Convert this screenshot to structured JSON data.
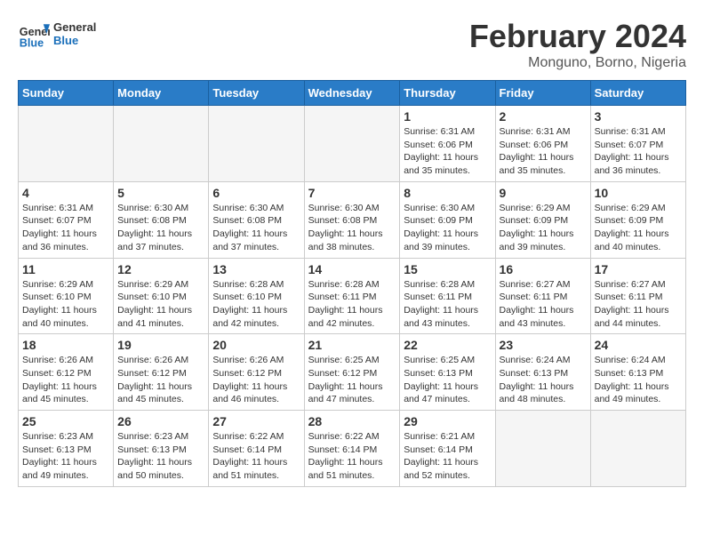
{
  "logo": {
    "text_general": "General",
    "text_blue": "Blue"
  },
  "title": "February 2024",
  "subtitle": "Monguno, Borno, Nigeria",
  "weekdays": [
    "Sunday",
    "Monday",
    "Tuesday",
    "Wednesday",
    "Thursday",
    "Friday",
    "Saturday"
  ],
  "weeks": [
    [
      {
        "day": "",
        "info": ""
      },
      {
        "day": "",
        "info": ""
      },
      {
        "day": "",
        "info": ""
      },
      {
        "day": "",
        "info": ""
      },
      {
        "day": "1",
        "info": "Sunrise: 6:31 AM\nSunset: 6:06 PM\nDaylight: 11 hours and 35 minutes."
      },
      {
        "day": "2",
        "info": "Sunrise: 6:31 AM\nSunset: 6:06 PM\nDaylight: 11 hours and 35 minutes."
      },
      {
        "day": "3",
        "info": "Sunrise: 6:31 AM\nSunset: 6:07 PM\nDaylight: 11 hours and 36 minutes."
      }
    ],
    [
      {
        "day": "4",
        "info": "Sunrise: 6:31 AM\nSunset: 6:07 PM\nDaylight: 11 hours and 36 minutes."
      },
      {
        "day": "5",
        "info": "Sunrise: 6:30 AM\nSunset: 6:08 PM\nDaylight: 11 hours and 37 minutes."
      },
      {
        "day": "6",
        "info": "Sunrise: 6:30 AM\nSunset: 6:08 PM\nDaylight: 11 hours and 37 minutes."
      },
      {
        "day": "7",
        "info": "Sunrise: 6:30 AM\nSunset: 6:08 PM\nDaylight: 11 hours and 38 minutes."
      },
      {
        "day": "8",
        "info": "Sunrise: 6:30 AM\nSunset: 6:09 PM\nDaylight: 11 hours and 39 minutes."
      },
      {
        "day": "9",
        "info": "Sunrise: 6:29 AM\nSunset: 6:09 PM\nDaylight: 11 hours and 39 minutes."
      },
      {
        "day": "10",
        "info": "Sunrise: 6:29 AM\nSunset: 6:09 PM\nDaylight: 11 hours and 40 minutes."
      }
    ],
    [
      {
        "day": "11",
        "info": "Sunrise: 6:29 AM\nSunset: 6:10 PM\nDaylight: 11 hours and 40 minutes."
      },
      {
        "day": "12",
        "info": "Sunrise: 6:29 AM\nSunset: 6:10 PM\nDaylight: 11 hours and 41 minutes."
      },
      {
        "day": "13",
        "info": "Sunrise: 6:28 AM\nSunset: 6:10 PM\nDaylight: 11 hours and 42 minutes."
      },
      {
        "day": "14",
        "info": "Sunrise: 6:28 AM\nSunset: 6:11 PM\nDaylight: 11 hours and 42 minutes."
      },
      {
        "day": "15",
        "info": "Sunrise: 6:28 AM\nSunset: 6:11 PM\nDaylight: 11 hours and 43 minutes."
      },
      {
        "day": "16",
        "info": "Sunrise: 6:27 AM\nSunset: 6:11 PM\nDaylight: 11 hours and 43 minutes."
      },
      {
        "day": "17",
        "info": "Sunrise: 6:27 AM\nSunset: 6:11 PM\nDaylight: 11 hours and 44 minutes."
      }
    ],
    [
      {
        "day": "18",
        "info": "Sunrise: 6:26 AM\nSunset: 6:12 PM\nDaylight: 11 hours and 45 minutes."
      },
      {
        "day": "19",
        "info": "Sunrise: 6:26 AM\nSunset: 6:12 PM\nDaylight: 11 hours and 45 minutes."
      },
      {
        "day": "20",
        "info": "Sunrise: 6:26 AM\nSunset: 6:12 PM\nDaylight: 11 hours and 46 minutes."
      },
      {
        "day": "21",
        "info": "Sunrise: 6:25 AM\nSunset: 6:12 PM\nDaylight: 11 hours and 47 minutes."
      },
      {
        "day": "22",
        "info": "Sunrise: 6:25 AM\nSunset: 6:13 PM\nDaylight: 11 hours and 47 minutes."
      },
      {
        "day": "23",
        "info": "Sunrise: 6:24 AM\nSunset: 6:13 PM\nDaylight: 11 hours and 48 minutes."
      },
      {
        "day": "24",
        "info": "Sunrise: 6:24 AM\nSunset: 6:13 PM\nDaylight: 11 hours and 49 minutes."
      }
    ],
    [
      {
        "day": "25",
        "info": "Sunrise: 6:23 AM\nSunset: 6:13 PM\nDaylight: 11 hours and 49 minutes."
      },
      {
        "day": "26",
        "info": "Sunrise: 6:23 AM\nSunset: 6:13 PM\nDaylight: 11 hours and 50 minutes."
      },
      {
        "day": "27",
        "info": "Sunrise: 6:22 AM\nSunset: 6:14 PM\nDaylight: 11 hours and 51 minutes."
      },
      {
        "day": "28",
        "info": "Sunrise: 6:22 AM\nSunset: 6:14 PM\nDaylight: 11 hours and 51 minutes."
      },
      {
        "day": "29",
        "info": "Sunrise: 6:21 AM\nSunset: 6:14 PM\nDaylight: 11 hours and 52 minutes."
      },
      {
        "day": "",
        "info": ""
      },
      {
        "day": "",
        "info": ""
      }
    ]
  ]
}
